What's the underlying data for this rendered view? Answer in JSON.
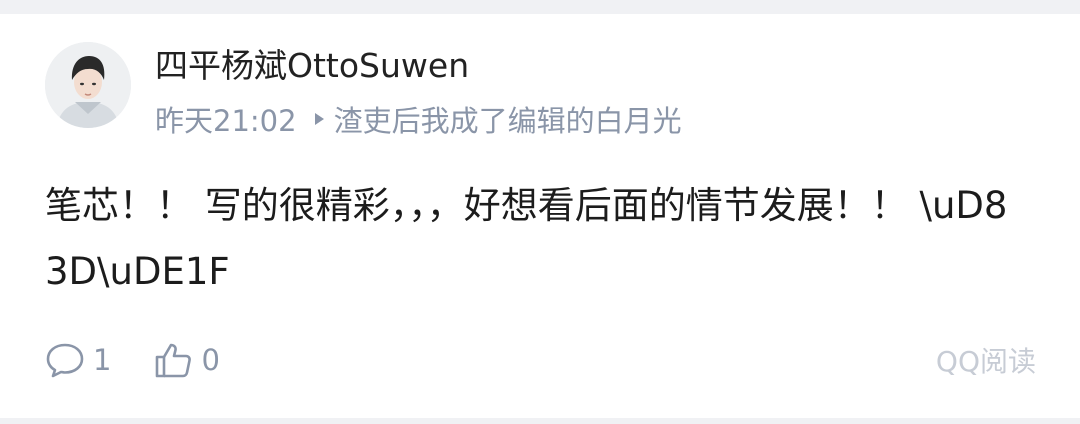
{
  "post": {
    "author": "四平杨斌OttoSuwen",
    "time": "昨天21:02",
    "book_title": "渣吏后我成了编辑的白月光",
    "content": "笔芯！！ 写的很精彩，，，好想看后面的情节发展！！ \\uD83D\\uDE1F"
  },
  "actions": {
    "comment_icon": "comment-bubble-icon",
    "comment_count": "1",
    "like_icon": "thumbs-up-icon",
    "like_count": "0"
  },
  "source": "QQ阅读",
  "colors": {
    "author": "#222222",
    "meta": "#8a95a8",
    "content": "#1c1c1c",
    "source": "#c7ccd5",
    "divider": "#f0f1f4"
  }
}
